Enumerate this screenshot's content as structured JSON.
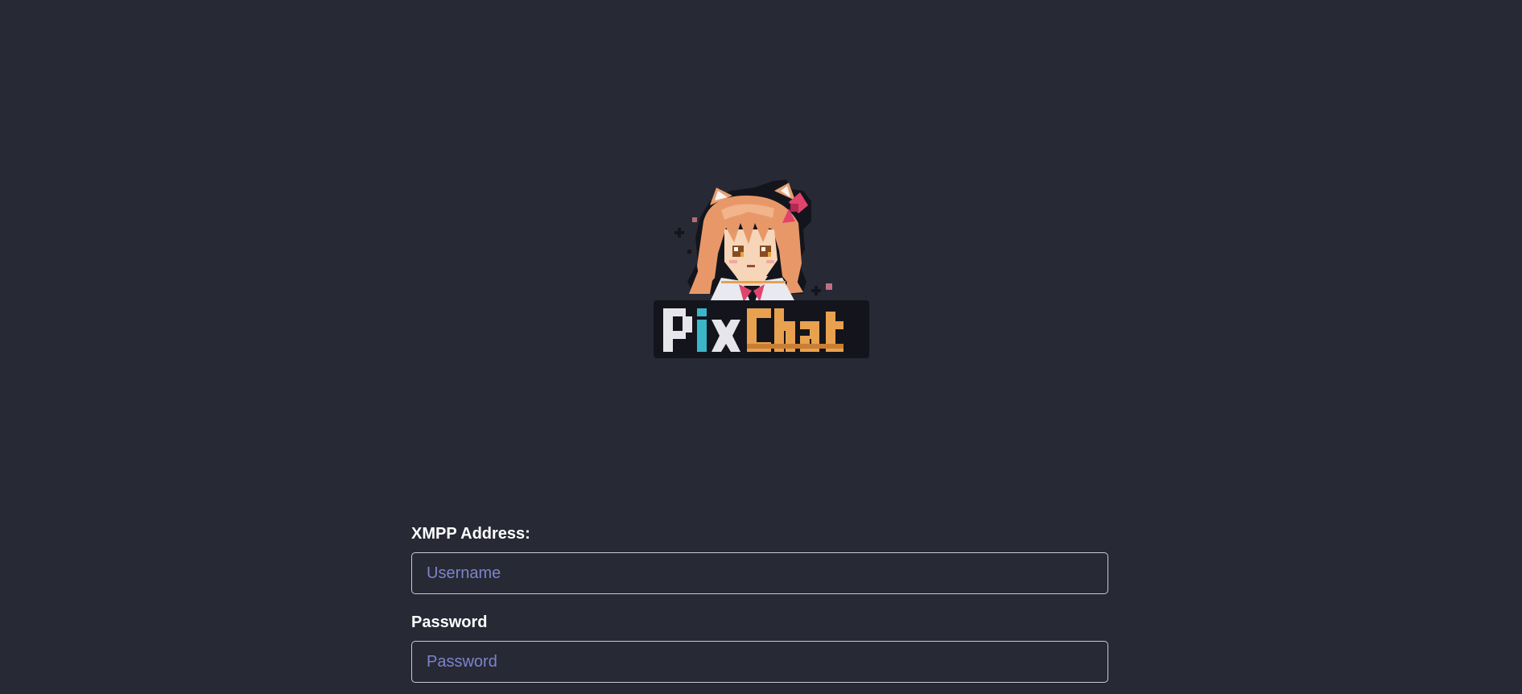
{
  "logo": {
    "text_part1": "Pix",
    "text_part2": "Chat",
    "icon": "pixel-anime-girl-mascot-icon"
  },
  "form": {
    "address": {
      "label": "XMPP Address:",
      "placeholder": "Username",
      "value": ""
    },
    "password": {
      "label": "Password",
      "placeholder": "Password",
      "value": ""
    }
  },
  "colors": {
    "background": "#272935",
    "input_border": "#c9ccd6",
    "placeholder": "#7c84c9",
    "label": "#ffffff",
    "logo_orange": "#e8a14e",
    "logo_teal": "#3bb6c8",
    "logo_pink": "#e0446d"
  }
}
